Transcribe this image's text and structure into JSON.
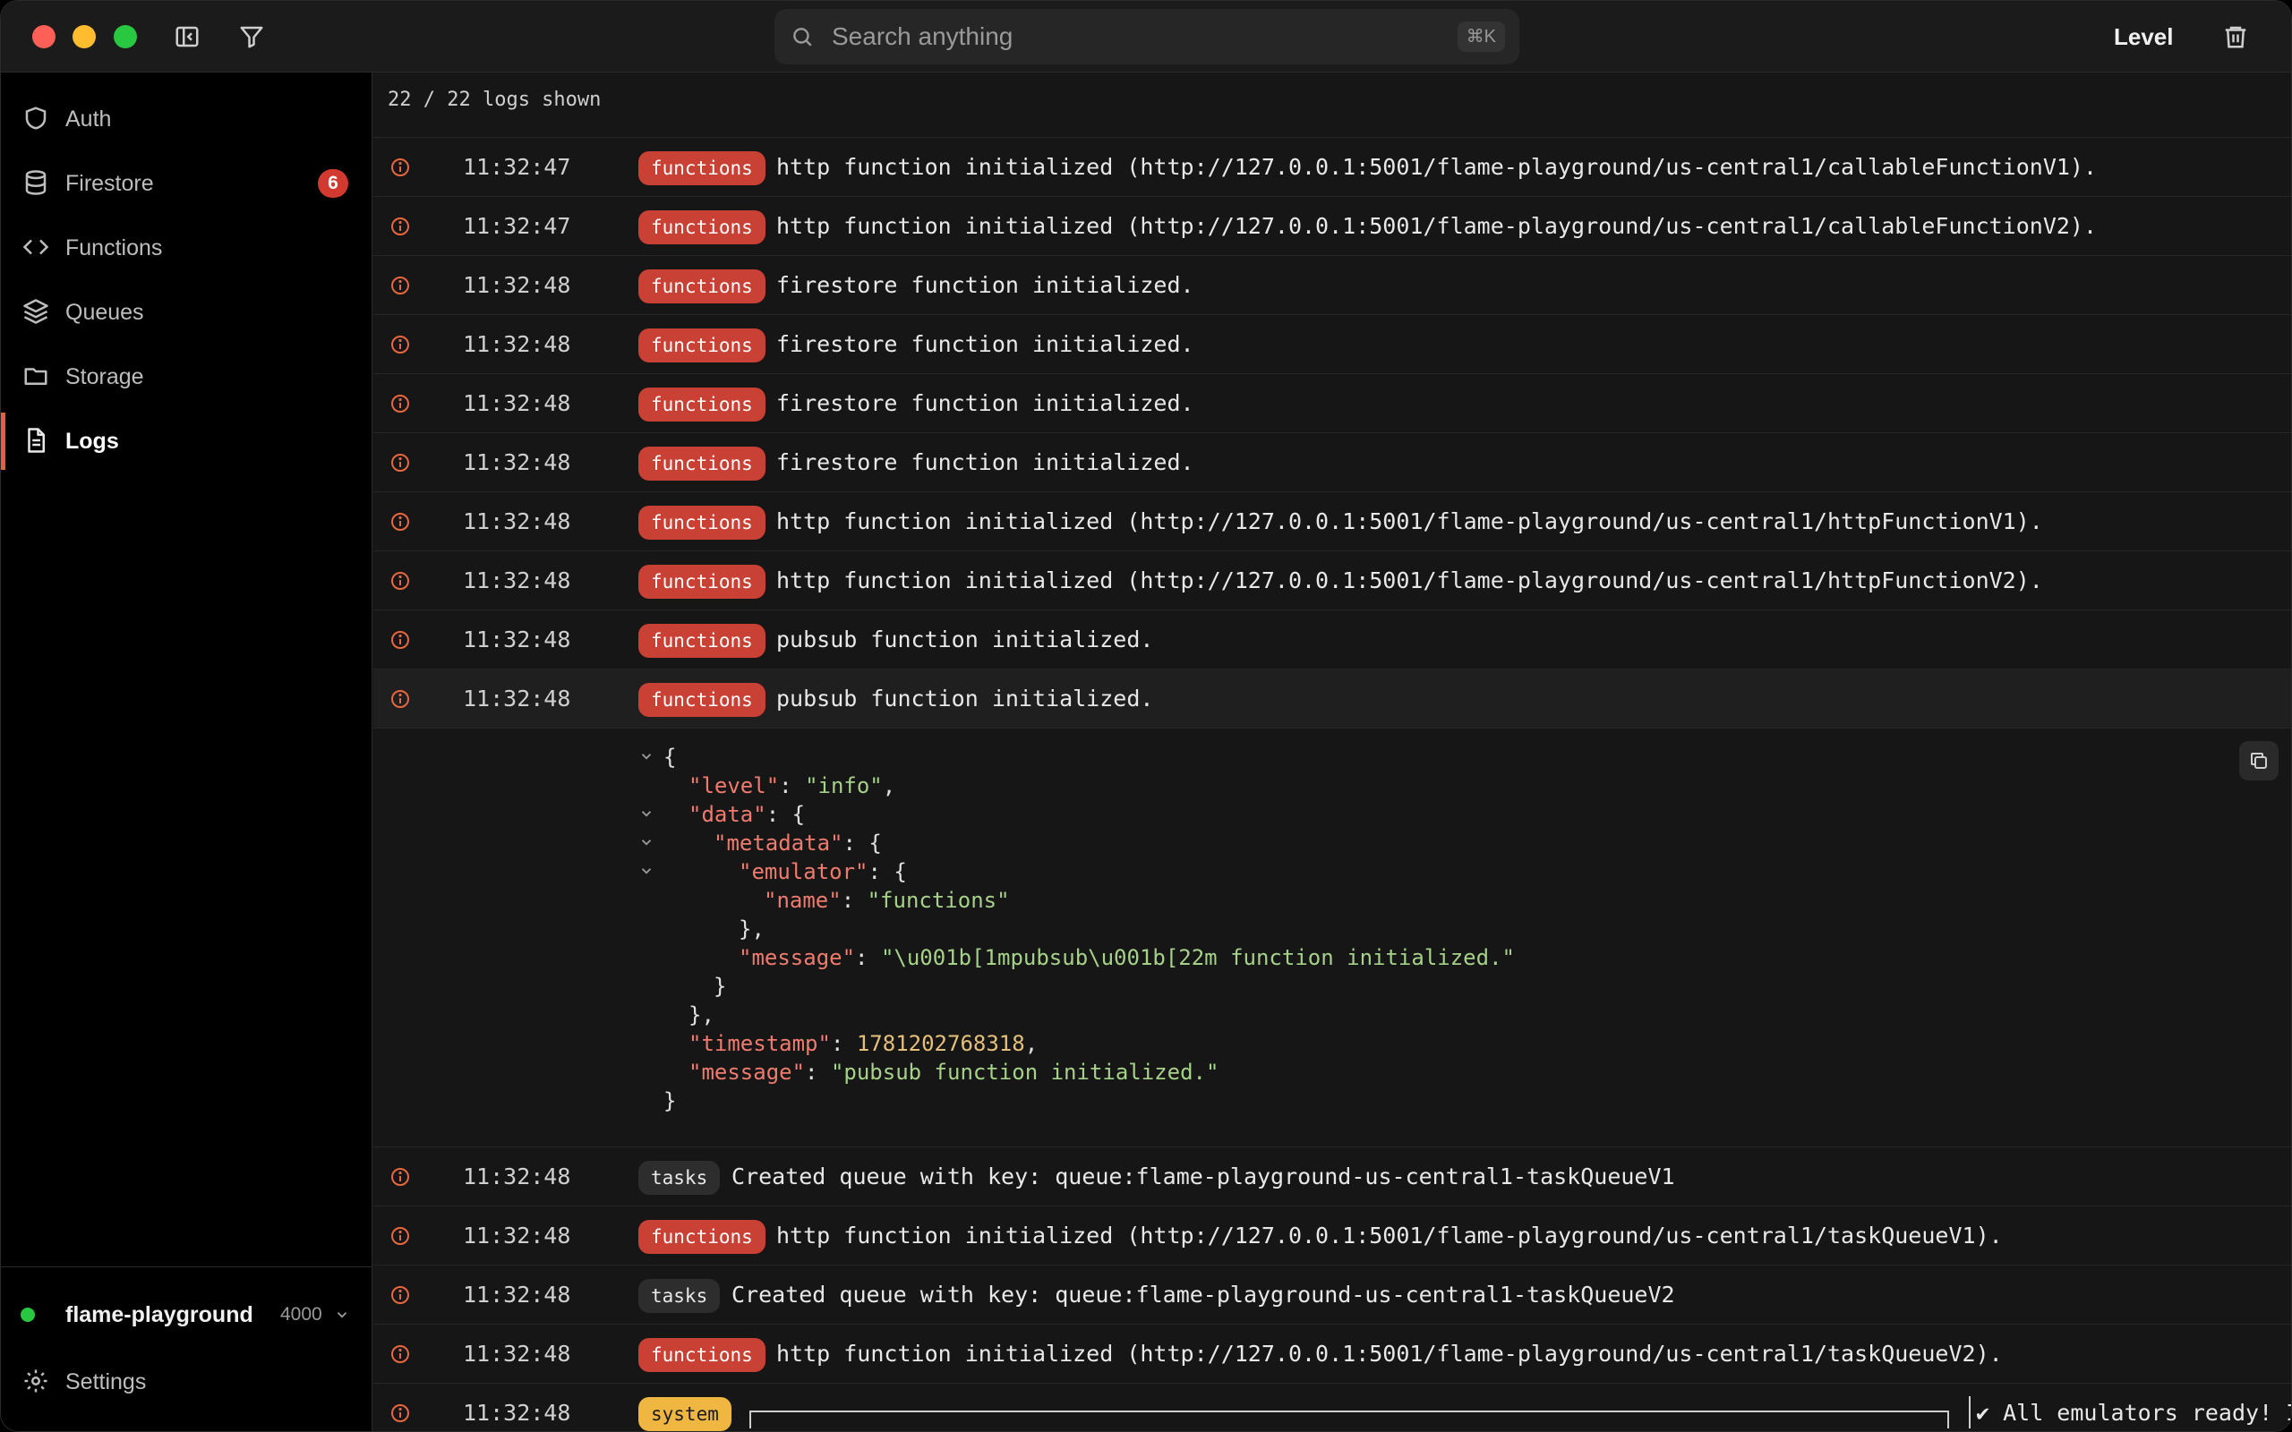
{
  "titlebar": {
    "search_placeholder": "Search anything",
    "search_shortcut": "⌘K",
    "level_label": "Level"
  },
  "sidebar": {
    "items": [
      {
        "label": "Auth",
        "icon": "shield-icon"
      },
      {
        "label": "Firestore",
        "icon": "database-icon",
        "badge": "6"
      },
      {
        "label": "Functions",
        "icon": "code-icon"
      },
      {
        "label": "Queues",
        "icon": "layers-icon"
      },
      {
        "label": "Storage",
        "icon": "folder-icon"
      },
      {
        "label": "Logs",
        "icon": "document-icon",
        "active": true
      }
    ],
    "project": {
      "name": "flame-playground",
      "port": "4000",
      "status_color": "#28c840"
    },
    "settings_label": "Settings"
  },
  "logs": {
    "count_text": "22 / 22 logs shown",
    "rows": [
      {
        "time": "11:32:47",
        "tag": "functions",
        "message": "http function initialized (http://127.0.0.1:5001/flame-playground/us-central1/callableFunctionV1)."
      },
      {
        "time": "11:32:47",
        "tag": "functions",
        "message": "http function initialized (http://127.0.0.1:5001/flame-playground/us-central1/callableFunctionV2)."
      },
      {
        "time": "11:32:48",
        "tag": "functions",
        "message": "firestore function initialized."
      },
      {
        "time": "11:32:48",
        "tag": "functions",
        "message": "firestore function initialized."
      },
      {
        "time": "11:32:48",
        "tag": "functions",
        "message": "firestore function initialized."
      },
      {
        "time": "11:32:48",
        "tag": "functions",
        "message": "firestore function initialized."
      },
      {
        "time": "11:32:48",
        "tag": "functions",
        "message": "http function initialized (http://127.0.0.1:5001/flame-playground/us-central1/httpFunctionV1)."
      },
      {
        "time": "11:32:48",
        "tag": "functions",
        "message": "http function initialized (http://127.0.0.1:5001/flame-playground/us-central1/httpFunctionV2)."
      },
      {
        "time": "11:32:48",
        "tag": "functions",
        "message": "pubsub function initialized."
      },
      {
        "time": "11:32:48",
        "tag": "functions",
        "message": "pubsub function initialized.",
        "selected": true
      }
    ],
    "rows_after": [
      {
        "time": "11:32:48",
        "tag": "tasks",
        "message": "Created queue with key: queue:flame-playground-us-central1-taskQueueV1"
      },
      {
        "time": "11:32:48",
        "tag": "functions",
        "message": "http function initialized (http://127.0.0.1:5001/flame-playground/us-central1/taskQueueV1)."
      },
      {
        "time": "11:32:48",
        "tag": "tasks",
        "message": "Created queue with key: queue:flame-playground-us-central1-taskQueueV2"
      },
      {
        "time": "11:32:48",
        "tag": "functions",
        "message": "http function initialized (http://127.0.0.1:5001/flame-playground/us-central1/taskQueueV2)."
      },
      {
        "time": "11:32:48",
        "tag": "system",
        "message": "✔ All emulators ready! It is now safe to connect…"
      }
    ],
    "detail": {
      "level_key": "\"level\"",
      "level_val": "\"info\"",
      "data_key": "\"data\"",
      "metadata_key": "\"metadata\"",
      "emulator_key": "\"emulator\"",
      "name_key": "\"name\"",
      "name_val": "\"functions\"",
      "inner_message_key": "\"message\"",
      "inner_message_val": "\"\\u001b[1mpubsub\\u001b[22m function initialized.\"",
      "timestamp_key": "\"timestamp\"",
      "timestamp_val": "1781202768318",
      "message_key": "\"message\"",
      "message_val": "\"pubsub function initialized.\""
    }
  },
  "colors": {
    "accent": "#e85d3f",
    "functions_tag": "#c94034",
    "system_tag": "#f0b642",
    "tasks_tag": "#2d2d2d"
  }
}
